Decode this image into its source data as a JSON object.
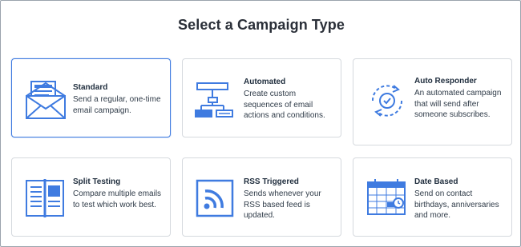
{
  "page": {
    "title": "Select a Campaign Type"
  },
  "colors": {
    "accent": "#3f7be0",
    "selected_border": "#3f7be0",
    "card_border": "#d5d9de"
  },
  "cards": [
    {
      "name": "Standard",
      "description": "Send a regular, one-time email campaign.",
      "icon": "envelope-icon",
      "selected": true
    },
    {
      "name": "Automated",
      "description": "Create custom sequences of email actions and conditions.",
      "icon": "flowchart-icon",
      "selected": false
    },
    {
      "name": "Auto Responder",
      "description": "An automated campaign that will send after someone subscribes.",
      "icon": "autoresponder-cycle-icon",
      "selected": false
    },
    {
      "name": "Split Testing",
      "description": "Compare multiple emails to test which work best.",
      "icon": "split-layout-icon",
      "selected": false
    },
    {
      "name": "RSS Triggered",
      "description": "Sends whenever your RSS based feed is updated.",
      "icon": "rss-icon",
      "selected": false
    },
    {
      "name": "Date Based",
      "description": "Send on contact birthdays, anniversaries and more.",
      "icon": "calendar-clock-icon",
      "selected": false
    }
  ]
}
